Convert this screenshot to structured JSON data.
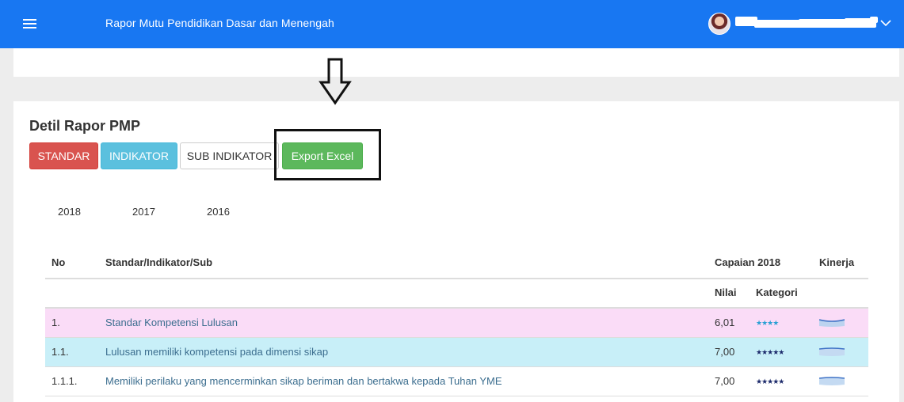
{
  "header": {
    "app_title": "Rapor Mutu Pendidikan Dasar dan Menengah",
    "menu_icon": "hamburger-icon",
    "user_avatar_icon": "user-avatar",
    "dropdown_icon": "chevron-down-icon"
  },
  "page": {
    "title": "Detil Rapor PMP",
    "buttons": {
      "standar": "STANDAR",
      "indikator": "INDIKATOR",
      "sub_indikator": "SUB INDIKATOR",
      "export_excel": "Export Excel"
    },
    "year_tabs": [
      "2018",
      "2017",
      "2016"
    ]
  },
  "table": {
    "headers": {
      "no": "No",
      "standar": "Standar/Indikator/Sub",
      "capaian": "Capaian 2018",
      "kinerja": "Kinerja",
      "nilai": "Nilai",
      "kategori": "Kategori"
    },
    "rows": [
      {
        "no": "1.",
        "label": "Standar Kompetensi Lulusan",
        "nilai": "6,01",
        "stars": "★★★★",
        "row_color": "#fadcf7",
        "star_color": "#2aa0d4"
      },
      {
        "no": "1.1.",
        "label": "Lulusan memiliki kompetensi pada dimensi sikap",
        "nilai": "7,00",
        "stars": "★★★★★",
        "row_color": "#c8eff8",
        "star_color": "#1c2a6b"
      },
      {
        "no": "1.1.1.",
        "label": "Memiliki perilaku yang mencerminkan sikap beriman dan bertakwa kepada Tuhan YME",
        "nilai": "7,00",
        "stars": "★★★★★",
        "row_color": "#ffffff",
        "star_color": "#1c2a6b"
      }
    ]
  },
  "colors": {
    "topbar": "#1877f2",
    "btn_standar": "#d9534f",
    "btn_indikator": "#5bc0de",
    "btn_export": "#5cb85c"
  }
}
